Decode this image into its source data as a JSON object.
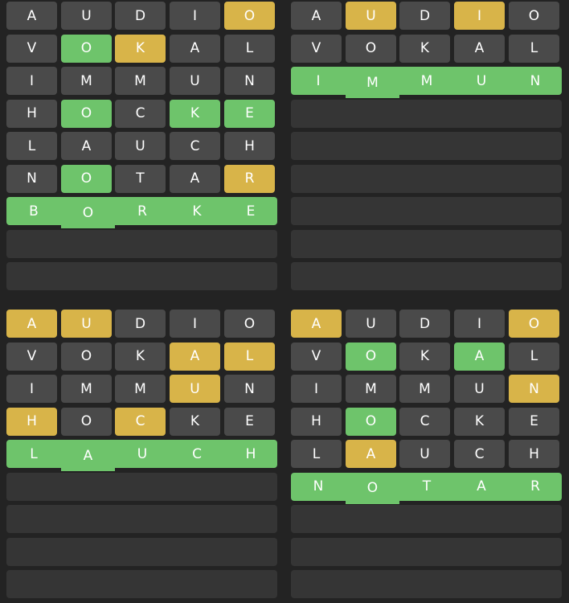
{
  "colors": {
    "background": "#232323",
    "correct": "#6ec46b",
    "present": "#d8b449",
    "absent": "#4a4a4a",
    "empty_row": "#353535",
    "letter": "#ffffff"
  },
  "boards": [
    {
      "solved": true,
      "guesses": [
        [
          {
            "l": "A",
            "s": "absent"
          },
          {
            "l": "U",
            "s": "absent"
          },
          {
            "l": "D",
            "s": "absent"
          },
          {
            "l": "I",
            "s": "absent"
          },
          {
            "l": "O",
            "s": "present"
          }
        ],
        [
          {
            "l": "V",
            "s": "absent"
          },
          {
            "l": "O",
            "s": "correct"
          },
          {
            "l": "K",
            "s": "present"
          },
          {
            "l": "A",
            "s": "absent"
          },
          {
            "l": "L",
            "s": "absent"
          }
        ],
        [
          {
            "l": "I",
            "s": "absent"
          },
          {
            "l": "M",
            "s": "absent"
          },
          {
            "l": "M",
            "s": "absent"
          },
          {
            "l": "U",
            "s": "absent"
          },
          {
            "l": "N",
            "s": "absent"
          }
        ],
        [
          {
            "l": "H",
            "s": "absent"
          },
          {
            "l": "O",
            "s": "correct"
          },
          {
            "l": "C",
            "s": "absent"
          },
          {
            "l": "K",
            "s": "correct"
          },
          {
            "l": "E",
            "s": "correct"
          }
        ],
        [
          {
            "l": "L",
            "s": "absent"
          },
          {
            "l": "A",
            "s": "absent"
          },
          {
            "l": "U",
            "s": "absent"
          },
          {
            "l": "C",
            "s": "absent"
          },
          {
            "l": "H",
            "s": "absent"
          }
        ],
        [
          {
            "l": "N",
            "s": "absent"
          },
          {
            "l": "O",
            "s": "correct"
          },
          {
            "l": "T",
            "s": "absent"
          },
          {
            "l": "A",
            "s": "absent"
          },
          {
            "l": "R",
            "s": "present"
          }
        ],
        [
          {
            "l": "B",
            "s": "correct"
          },
          {
            "l": "O",
            "s": "correct"
          },
          {
            "l": "R",
            "s": "correct"
          },
          {
            "l": "K",
            "s": "correct"
          },
          {
            "l": "E",
            "s": "correct"
          }
        ]
      ],
      "empty_rows": 2
    },
    {
      "solved": true,
      "guesses": [
        [
          {
            "l": "A",
            "s": "absent"
          },
          {
            "l": "U",
            "s": "present"
          },
          {
            "l": "D",
            "s": "absent"
          },
          {
            "l": "I",
            "s": "present"
          },
          {
            "l": "O",
            "s": "absent"
          }
        ],
        [
          {
            "l": "V",
            "s": "absent"
          },
          {
            "l": "O",
            "s": "absent"
          },
          {
            "l": "K",
            "s": "absent"
          },
          {
            "l": "A",
            "s": "absent"
          },
          {
            "l": "L",
            "s": "absent"
          }
        ],
        [
          {
            "l": "I",
            "s": "correct"
          },
          {
            "l": "M",
            "s": "correct"
          },
          {
            "l": "M",
            "s": "correct"
          },
          {
            "l": "U",
            "s": "correct"
          },
          {
            "l": "N",
            "s": "correct"
          }
        ]
      ],
      "empty_rows": 6
    },
    {
      "solved": true,
      "guesses": [
        [
          {
            "l": "A",
            "s": "present"
          },
          {
            "l": "U",
            "s": "present"
          },
          {
            "l": "D",
            "s": "absent"
          },
          {
            "l": "I",
            "s": "absent"
          },
          {
            "l": "O",
            "s": "absent"
          }
        ],
        [
          {
            "l": "V",
            "s": "absent"
          },
          {
            "l": "O",
            "s": "absent"
          },
          {
            "l": "K",
            "s": "absent"
          },
          {
            "l": "A",
            "s": "present"
          },
          {
            "l": "L",
            "s": "present"
          }
        ],
        [
          {
            "l": "I",
            "s": "absent"
          },
          {
            "l": "M",
            "s": "absent"
          },
          {
            "l": "M",
            "s": "absent"
          },
          {
            "l": "U",
            "s": "present"
          },
          {
            "l": "N",
            "s": "absent"
          }
        ],
        [
          {
            "l": "H",
            "s": "present"
          },
          {
            "l": "O",
            "s": "absent"
          },
          {
            "l": "C",
            "s": "present"
          },
          {
            "l": "K",
            "s": "absent"
          },
          {
            "l": "E",
            "s": "absent"
          }
        ],
        [
          {
            "l": "L",
            "s": "correct"
          },
          {
            "l": "A",
            "s": "correct"
          },
          {
            "l": "U",
            "s": "correct"
          },
          {
            "l": "C",
            "s": "correct"
          },
          {
            "l": "H",
            "s": "correct"
          }
        ]
      ],
      "empty_rows": 4
    },
    {
      "solved": true,
      "guesses": [
        [
          {
            "l": "A",
            "s": "present"
          },
          {
            "l": "U",
            "s": "absent"
          },
          {
            "l": "D",
            "s": "absent"
          },
          {
            "l": "I",
            "s": "absent"
          },
          {
            "l": "O",
            "s": "present"
          }
        ],
        [
          {
            "l": "V",
            "s": "absent"
          },
          {
            "l": "O",
            "s": "correct"
          },
          {
            "l": "K",
            "s": "absent"
          },
          {
            "l": "A",
            "s": "correct"
          },
          {
            "l": "L",
            "s": "absent"
          }
        ],
        [
          {
            "l": "I",
            "s": "absent"
          },
          {
            "l": "M",
            "s": "absent"
          },
          {
            "l": "M",
            "s": "absent"
          },
          {
            "l": "U",
            "s": "absent"
          },
          {
            "l": "N",
            "s": "present"
          }
        ],
        [
          {
            "l": "H",
            "s": "absent"
          },
          {
            "l": "O",
            "s": "correct"
          },
          {
            "l": "C",
            "s": "absent"
          },
          {
            "l": "K",
            "s": "absent"
          },
          {
            "l": "E",
            "s": "absent"
          }
        ],
        [
          {
            "l": "L",
            "s": "absent"
          },
          {
            "l": "A",
            "s": "present"
          },
          {
            "l": "U",
            "s": "absent"
          },
          {
            "l": "C",
            "s": "absent"
          },
          {
            "l": "H",
            "s": "absent"
          }
        ],
        [
          {
            "l": "N",
            "s": "correct"
          },
          {
            "l": "O",
            "s": "correct"
          },
          {
            "l": "T",
            "s": "correct"
          },
          {
            "l": "A",
            "s": "correct"
          },
          {
            "l": "R",
            "s": "correct"
          }
        ]
      ],
      "empty_rows": 3
    }
  ]
}
